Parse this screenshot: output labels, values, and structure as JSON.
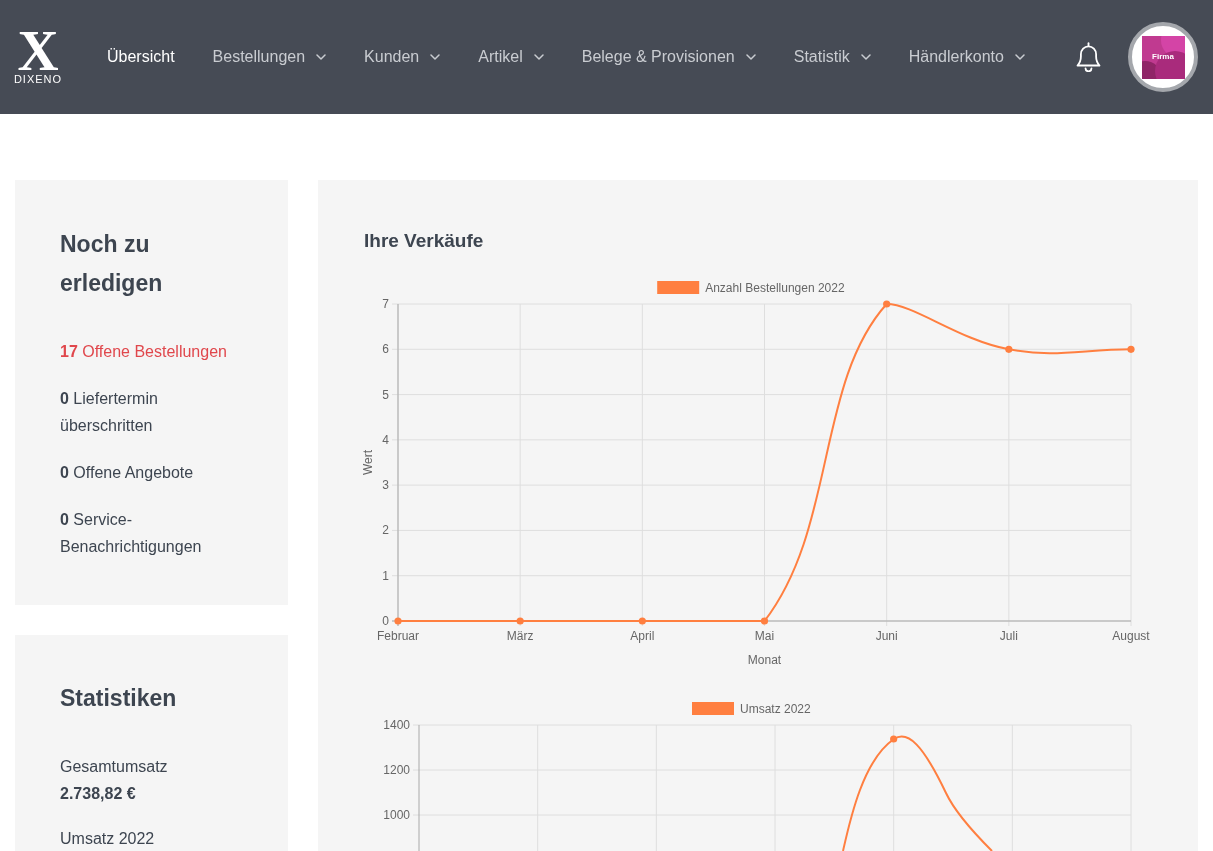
{
  "header": {
    "logo": {
      "mark": "X",
      "name": "DIXENO"
    },
    "nav": [
      {
        "label": "Übersicht",
        "selected": true,
        "dropdown": false
      },
      {
        "label": "Bestellungen",
        "selected": false,
        "dropdown": true
      },
      {
        "label": "Kunden",
        "selected": false,
        "dropdown": true
      },
      {
        "label": "Artikel",
        "selected": false,
        "dropdown": true
      },
      {
        "label": "Belege & Provisionen",
        "selected": false,
        "dropdown": true
      },
      {
        "label": "Statistik",
        "selected": false,
        "dropdown": true
      },
      {
        "label": "Händlerkonto",
        "selected": false,
        "dropdown": true
      }
    ],
    "account": {
      "logo_text": "Firma"
    }
  },
  "todo": {
    "title": "Noch zu erledigen",
    "items": [
      {
        "count": "17",
        "label": "Offene Bestellungen",
        "alert": true
      },
      {
        "count": "0",
        "label": "Liefertermin überschritten",
        "alert": false
      },
      {
        "count": "0",
        "label": "Offene Angebote",
        "alert": false
      },
      {
        "count": "0",
        "label": "Service-Benachrichtigungen",
        "alert": false
      }
    ]
  },
  "stats": {
    "title": "Statistiken",
    "items": [
      {
        "label": "Gesamtumsatz",
        "value": "2.738,82 €"
      },
      {
        "label": "Umsatz 2022"
      }
    ]
  },
  "sales": {
    "title": "Ihre Verkäufe",
    "orders_chart": {
      "chart_data": {
        "type": "line",
        "xlabel": "Monat",
        "ylabel": "Wert",
        "categories": [
          "Februar",
          "März",
          "April",
          "Mai",
          "Juni",
          "Juli",
          "August"
        ],
        "series": [
          {
            "name": "Anzahl Bestellungen 2022",
            "color": "#ff7f40",
            "marker": "circle",
            "values": [
              0,
              0,
              0,
              0,
              7,
              6,
              6
            ]
          }
        ],
        "ylim": [
          0,
          7
        ],
        "yticks": [
          0,
          1,
          2,
          3,
          4,
          5,
          6,
          7
        ],
        "grid": true
      }
    },
    "revenue_chart": {
      "legend": "Umsatz 2022",
      "y_tick_labels": [
        "1400",
        "1200",
        "1000"
      ]
    }
  }
}
